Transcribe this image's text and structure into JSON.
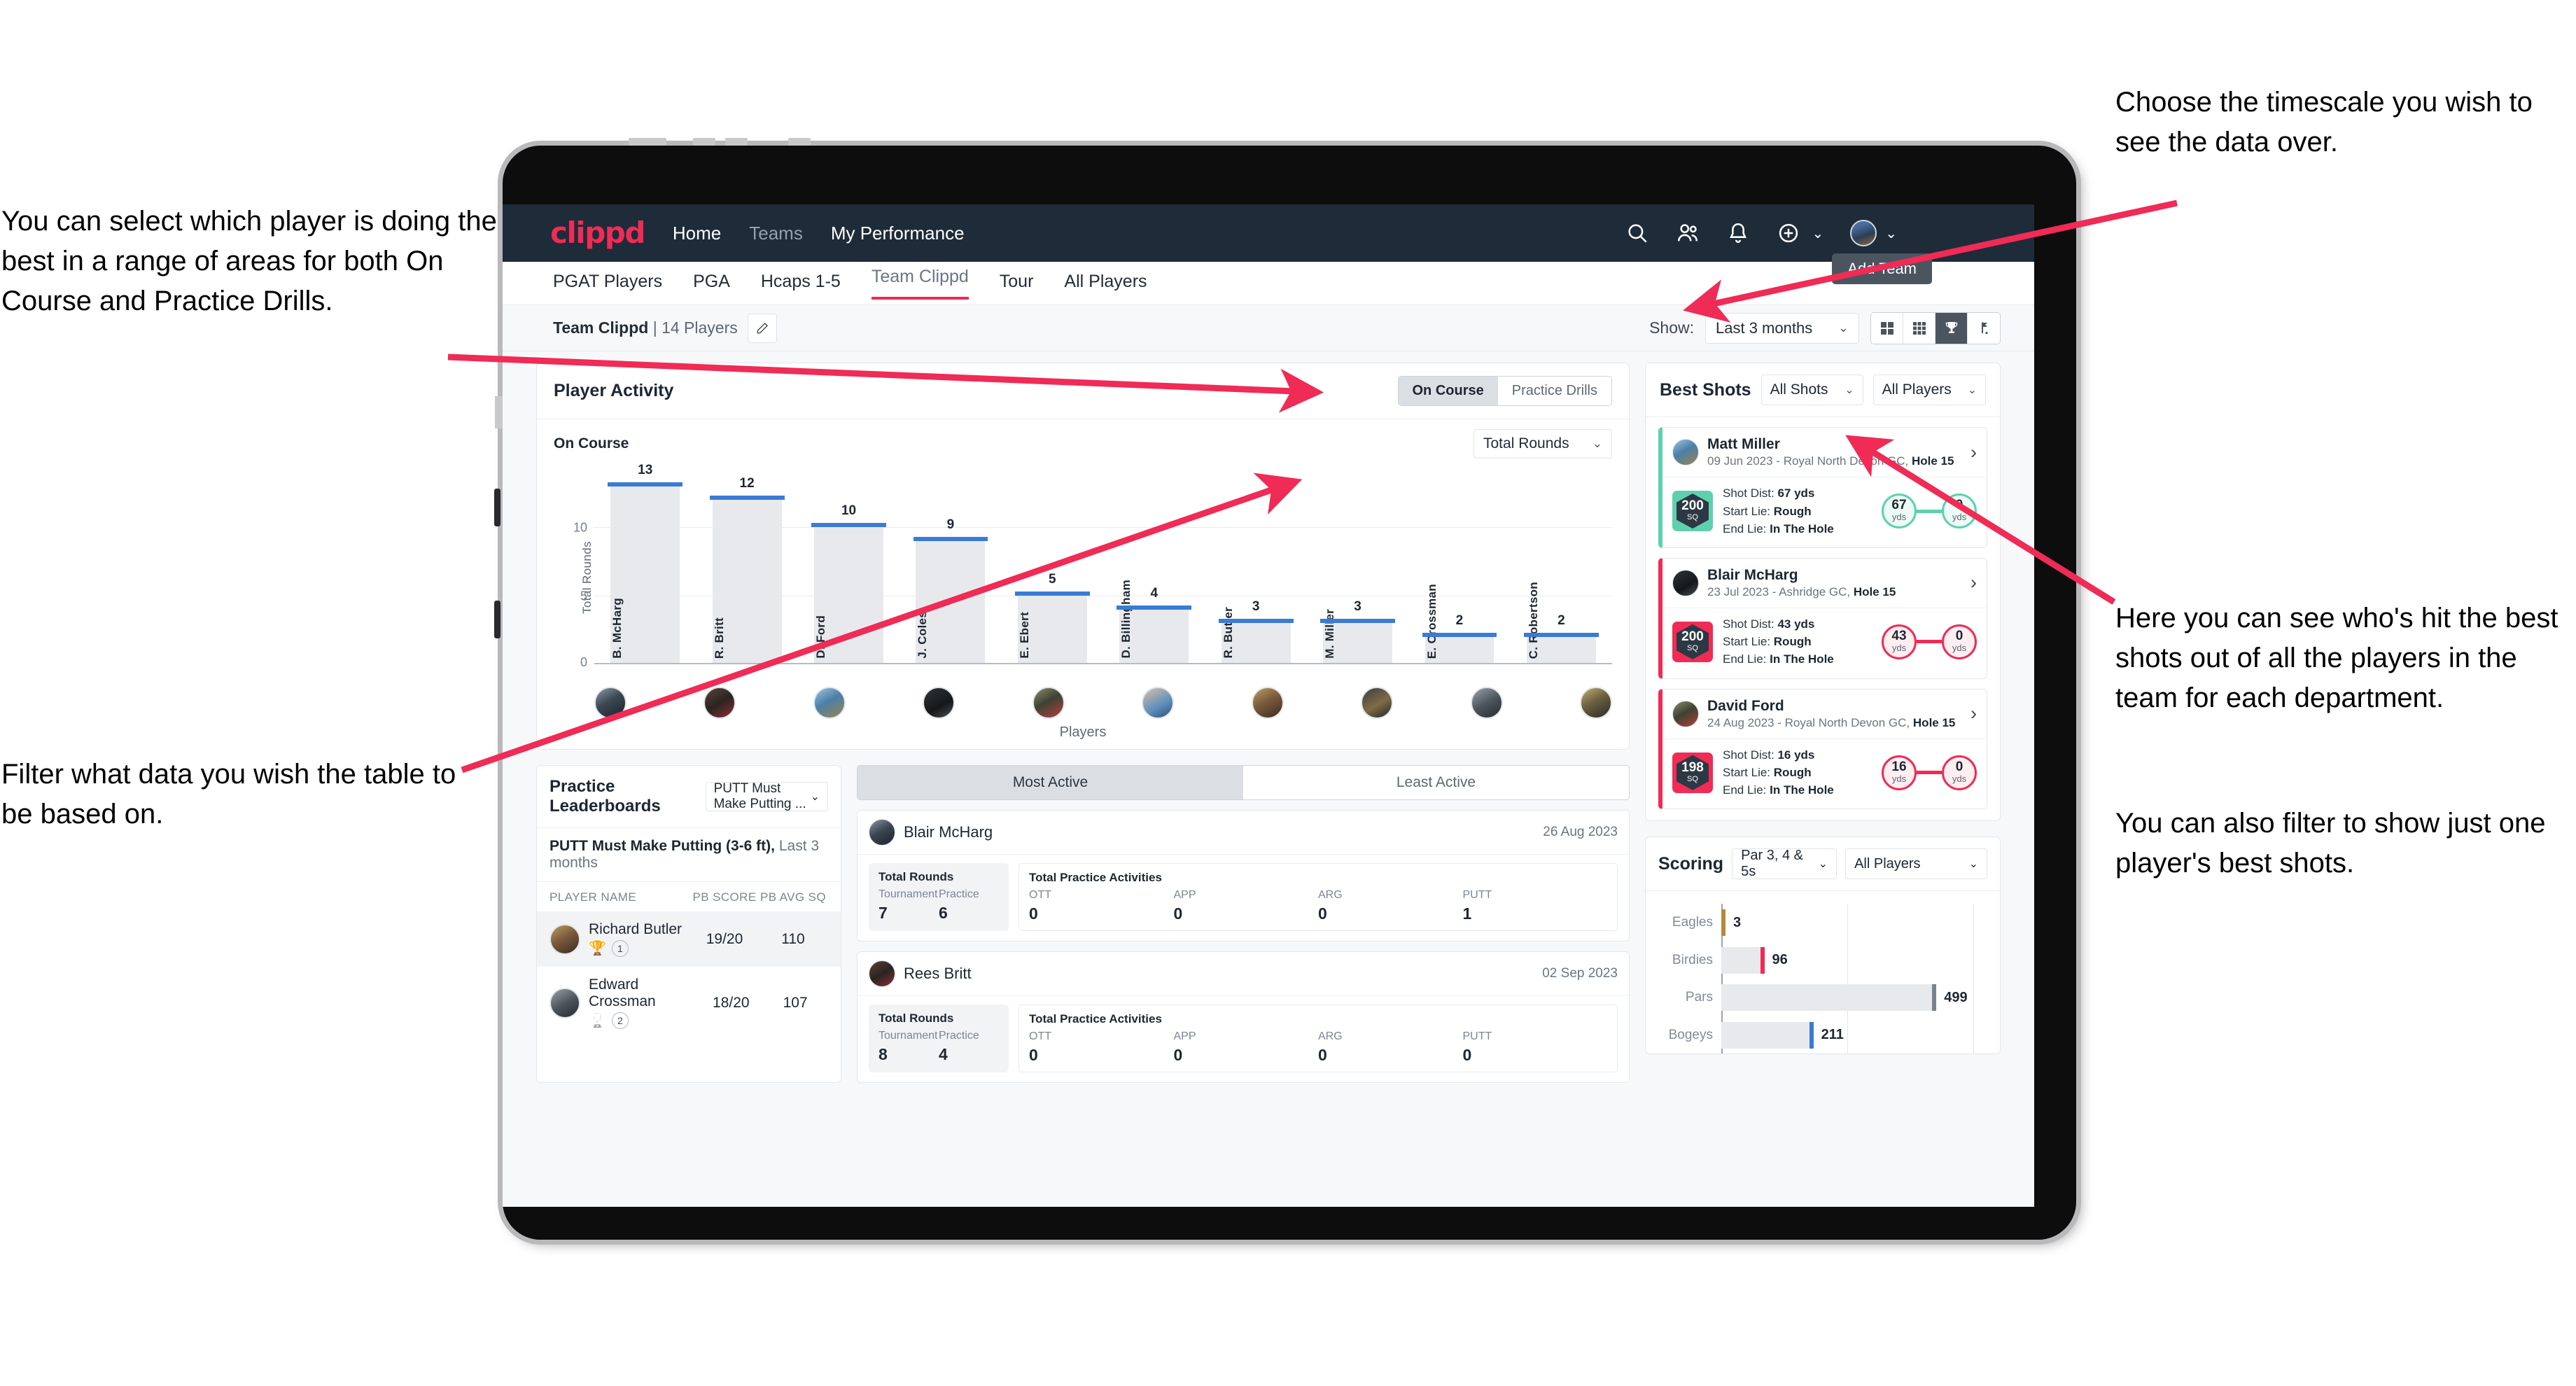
{
  "annotations": {
    "left_top": "You can select which player is doing the best in a range of areas for both On Course and Practice Drills.",
    "left_bottom": "Filter what data you wish the table to be based on.",
    "right_top": "Choose the timescale you wish to see the data over.",
    "right_middle": "Here you can see who's hit the best shots out of all the players in the team for each department.",
    "right_bottom": "You can also filter to show just one player's best shots."
  },
  "navbar": {
    "logo": "clippd",
    "links": [
      {
        "label": "Home",
        "dim": false
      },
      {
        "label": "Teams",
        "dim": true
      },
      {
        "label": "My Performance",
        "dim": false
      }
    ],
    "icons": [
      "search-icon",
      "people-icon",
      "bell-icon",
      "plus-circle-icon",
      "avatar"
    ]
  },
  "tabs": {
    "items": [
      "PGAT Players",
      "PGA",
      "Hcaps 1-5",
      "Team Clippd",
      "Tour",
      "All Players"
    ],
    "active": "Team Clippd",
    "tooltip": "Add Team"
  },
  "subheader": {
    "team_name": "Team Clippd",
    "separator": "|",
    "player_count": "14 Players",
    "show_label": "Show:",
    "timescale": "Last 3 months",
    "view_icons": [
      "grid-large-icon",
      "grid-small-icon",
      "trophy-icon",
      "flag-icon"
    ],
    "view_selected_index": 2
  },
  "player_activity": {
    "title": "Player Activity",
    "segments": [
      "On Course",
      "Practice Drills"
    ],
    "segment_selected": "On Course",
    "subtitle": "On Course",
    "metric": "Total Rounds"
  },
  "chart_data": {
    "type": "bar",
    "title": "Player Activity - On Course",
    "categories": [
      "B. McHarg",
      "R. Britt",
      "D. Ford",
      "J. Coles",
      "E. Ebert",
      "D. Billingham",
      "R. Butler",
      "M. Miller",
      "E. Crossman",
      "C. Robertson"
    ],
    "values": [
      13,
      12,
      10,
      9,
      5,
      4,
      3,
      3,
      2,
      2
    ],
    "xlabel": "Players",
    "ylabel": "Total Rounds",
    "ylim": [
      0,
      14
    ],
    "yticks": [
      0,
      5,
      10
    ],
    "grid": true,
    "legend": "none"
  },
  "best_shots": {
    "title": "Best Shots",
    "filter_shots": "All Shots",
    "filter_players": "All Players",
    "cards": [
      {
        "name": "Matt Miller",
        "meta_date": "09 Jun 2023 - Royal North Devon GC,",
        "meta_hole": "Hole 15",
        "sq": "200",
        "sq_unit": "SQ",
        "accent": "#5ed0ae",
        "shot_dist_label": "Shot Dist:",
        "shot_dist": "67 yds",
        "start_lie_label": "Start Lie:",
        "start_lie": "Rough",
        "end_lie_label": "End Lie:",
        "end_lie": "In The Hole",
        "from_val": "67",
        "from_unit": "yds",
        "to_val": "0",
        "to_unit": "yds"
      },
      {
        "name": "Blair McHarg",
        "meta_date": "23 Jul 2023 - Ashridge GC,",
        "meta_hole": "Hole 15",
        "sq": "200",
        "sq_unit": "SQ",
        "accent": "#ef2b56",
        "shot_dist_label": "Shot Dist:",
        "shot_dist": "43 yds",
        "start_lie_label": "Start Lie:",
        "start_lie": "Rough",
        "end_lie_label": "End Lie:",
        "end_lie": "In The Hole",
        "from_val": "43",
        "from_unit": "yds",
        "to_val": "0",
        "to_unit": "yds"
      },
      {
        "name": "David Ford",
        "meta_date": "24 Aug 2023 - Royal North Devon GC,",
        "meta_hole": "Hole 15",
        "sq": "198",
        "sq_unit": "SQ",
        "accent": "#ef2b56",
        "shot_dist_label": "Shot Dist:",
        "shot_dist": "16 yds",
        "start_lie_label": "Start Lie:",
        "start_lie": "Rough",
        "end_lie_label": "End Lie:",
        "end_lie": "In The Hole",
        "from_val": "16",
        "from_unit": "yds",
        "to_val": "0",
        "to_unit": "yds"
      }
    ]
  },
  "practice_leaderboards": {
    "title": "Practice Leaderboards",
    "selector": "PUTT Must Make Putting ...",
    "subtitle_bold": "PUTT Must Make Putting (3-6 ft),",
    "subtitle_rest": "Last 3 months",
    "columns": [
      "PLAYER NAME",
      "PB SCORE",
      "PB AVG SQ"
    ],
    "rows": [
      {
        "name": "Richard Butler",
        "rank": "1",
        "trophy": "gold",
        "pb_score": "19/20",
        "pb_avg_sq": "110"
      },
      {
        "name": "Edward Crossman",
        "rank": "2",
        "trophy": "silver",
        "pb_score": "18/20",
        "pb_avg_sq": "107"
      }
    ]
  },
  "activity": {
    "tabs": [
      "Most Active",
      "Least Active"
    ],
    "tab_selected": "Most Active",
    "cards": [
      {
        "name": "Blair McHarg",
        "date": "26 Aug 2023",
        "rounds_title": "Total Rounds",
        "rounds_keys": [
          "Tournament",
          "Practice"
        ],
        "rounds_vals": [
          "7",
          "6"
        ],
        "acts_title": "Total Practice Activities",
        "acts_keys": [
          "OTT",
          "APP",
          "ARG",
          "PUTT"
        ],
        "acts_vals": [
          "0",
          "0",
          "0",
          "1"
        ]
      },
      {
        "name": "Rees Britt",
        "date": "02 Sep 2023",
        "rounds_title": "Total Rounds",
        "rounds_keys": [
          "Tournament",
          "Practice"
        ],
        "rounds_vals": [
          "8",
          "4"
        ],
        "acts_title": "Total Practice Activities",
        "acts_keys": [
          "OTT",
          "APP",
          "ARG",
          "PUTT"
        ],
        "acts_vals": [
          "0",
          "0",
          "0",
          "0"
        ]
      }
    ]
  },
  "scoring": {
    "title": "Scoring",
    "filter_par": "Par 3, 4 & 5s",
    "filter_players": "All Players"
  },
  "scoring_chart": {
    "type": "bar",
    "orientation": "horizontal",
    "title": "Scoring",
    "categories": [
      "Eagles",
      "Birdies",
      "Pars",
      "Bogeys"
    ],
    "values": [
      3,
      96,
      499,
      211
    ],
    "colors": [
      "#b5893a",
      "#ef2b56",
      "#7a838c",
      "#3a7bd5"
    ],
    "xlim": [
      0,
      620
    ],
    "grid": true
  },
  "colors": {
    "brand_pink": "#ef2b56",
    "navy": "#1e2b38",
    "bar_blue": "#3a7bd5",
    "teal": "#5ed0ae"
  }
}
